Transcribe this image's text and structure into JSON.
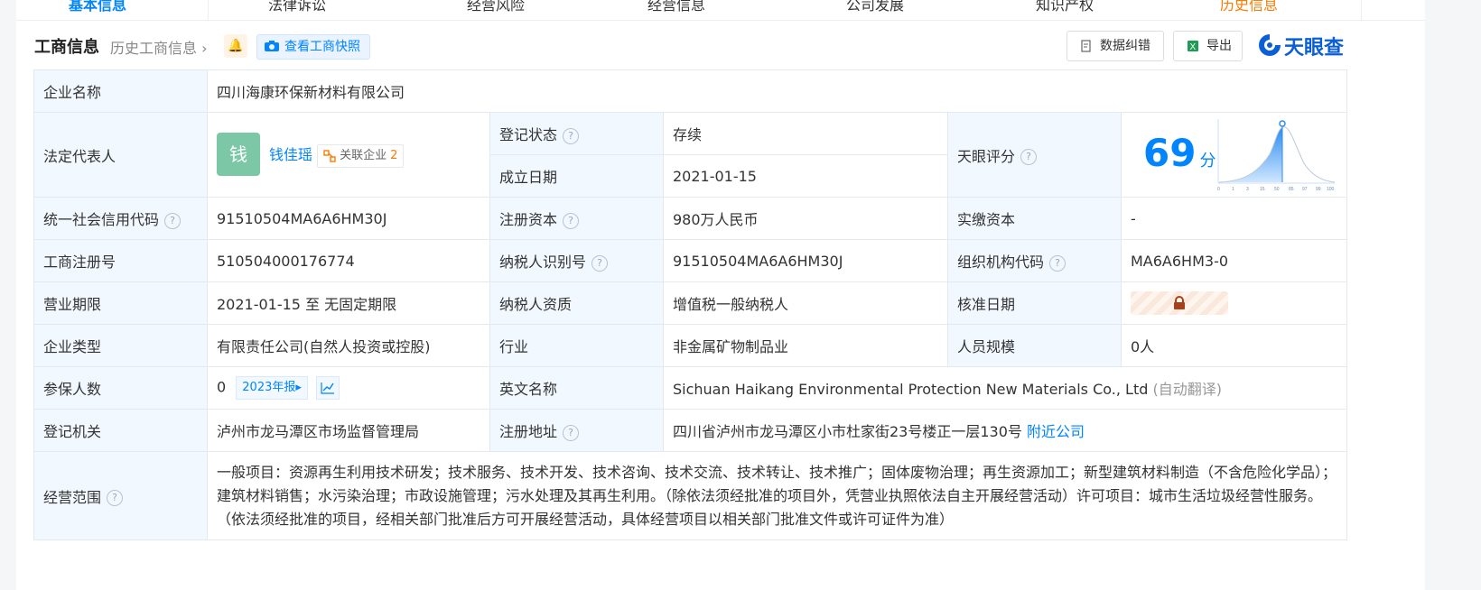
{
  "tabs": [
    "基本信息",
    "法律诉讼",
    "经营风险",
    "经营信息",
    "公司发展",
    "知识产权",
    "历史信息"
  ],
  "header": {
    "title": "工商信息",
    "history_link": "历史工商信息",
    "snapshot_label": "查看工商快照",
    "correct_button": "数据纠错",
    "export_button": "导出",
    "logo_text": "天眼查"
  },
  "company": {
    "name_label": "企业名称",
    "name": "四川海康环保新材料有限公司",
    "legal_rep_label": "法定代表人",
    "legal_rep_avatar": "钱",
    "legal_rep": "钱佳瑶",
    "related_label": "关联企业",
    "related_count": "2",
    "status_label": "登记状态",
    "status": "存续",
    "found_label": "成立日期",
    "found_date": "2021-01-15",
    "score_label": "天眼评分",
    "score": "69",
    "score_unit": "分",
    "score_axis": [
      "0",
      "1",
      "3",
      "15",
      "50",
      "85",
      "97",
      "99",
      "100"
    ],
    "credit_code_label": "统一社会信用代码",
    "credit_code": "91510504MA6A6HM30J",
    "reg_capital_label": "注册资本",
    "reg_capital": "980万人民币",
    "paid_capital_label": "实缴资本",
    "paid_capital": "-",
    "reg_no_label": "工商注册号",
    "reg_no": "510504000176774",
    "taxpayer_id_label": "纳税人识别号",
    "taxpayer_id": "91510504MA6A6HM30J",
    "org_code_label": "组织机构代码",
    "org_code": "MA6A6HM3-0",
    "term_label": "营业期限",
    "term": "2021-01-15 至 无固定期限",
    "taxpayer_type_label": "纳税人资质",
    "taxpayer_type": "增值税一般纳税人",
    "approve_label": "核准日期",
    "type_label": "企业类型",
    "type": "有限责任公司(自然人投资或控股)",
    "industry_label": "行业",
    "industry": "非金属矿物制品业",
    "staff_label": "人员规模",
    "staff": "0人",
    "insured_label": "参保人数",
    "insured": "0",
    "insured_year": "2023年报",
    "en_name_label": "英文名称",
    "en_name": "Sichuan Haikang Environmental Protection New Materials Co., Ltd",
    "en_auto": "(自动翻译)",
    "authority_label": "登记机关",
    "authority": "泸州市龙马潭区市场监督管理局",
    "address_label": "注册地址",
    "address": "四川省泸州市龙马潭区小市杜家街23号楼正一层130号",
    "nearby": "附近公司",
    "scope_label": "经营范围",
    "scope": "一般项目：资源再生利用技术研发；技术服务、技术开发、技术咨询、技术交流、技术转让、技术推广；固体废物治理；再生资源加工；新型建筑材料制造（不含危险化学品）；建筑材料销售；水污染治理；市政设施管理；污水处理及其再生利用。（除依法须经批准的项目外，凭营业执照依法自主开展经营活动）许可项目：城市生活垃圾经营性服务。（依法须经批准的项目，经相关部门批准后方可开展经营活动，具体经营项目以相关部门批准文件或许可证件为准）"
  },
  "colors": {
    "accent": "#0084ff",
    "status_green": "#1aaa55",
    "label_bg": "#f2f8ff"
  }
}
